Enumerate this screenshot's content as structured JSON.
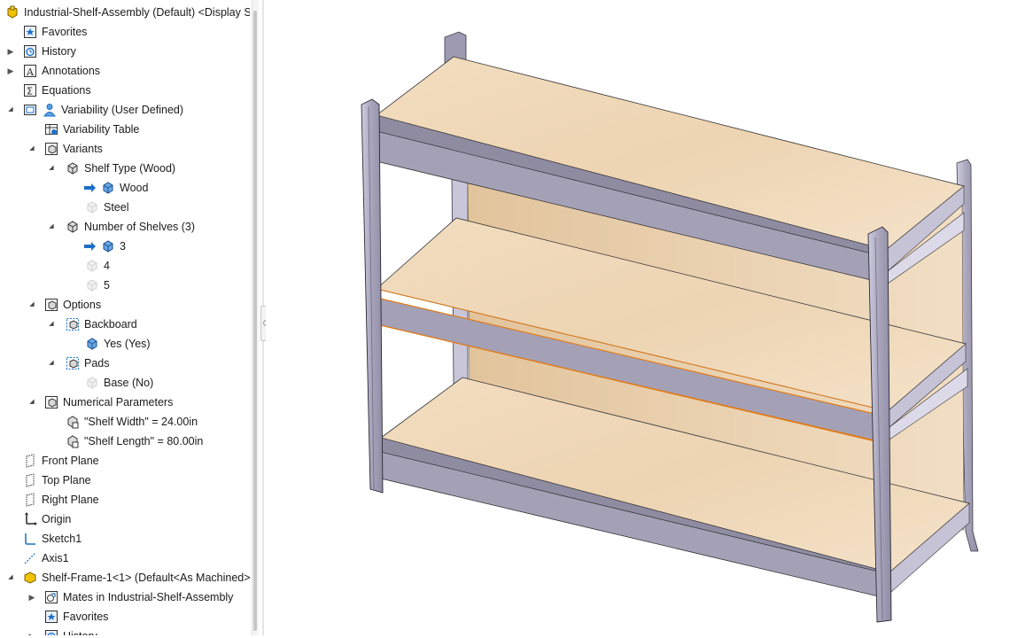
{
  "colors": {
    "wood": "#efd9bb",
    "metal": "#a7a4b8",
    "metal_dark": "#8c89a0",
    "highlight": "#e07a16",
    "arrow_blue": "#1c6fc9"
  },
  "tree": {
    "items": [
      {
        "label": "Industrial-Shelf-Assembly (Default) <Display Sta",
        "icon": "assembly-icon",
        "indent": 0
      },
      {
        "label": "Favorites",
        "icon": "favorites-icon",
        "indent": 1
      },
      {
        "label": "History",
        "icon": "history-icon",
        "indent": 1
      },
      {
        "label": "Annotations",
        "icon": "annotations-icon",
        "indent": 1
      },
      {
        "label": "Equations",
        "icon": "equations-icon",
        "indent": 1
      },
      {
        "label": "Variability (User Defined)",
        "icon": "variability-icon",
        "indent": 1
      },
      {
        "label": "Variability Table",
        "icon": "variability-table-icon",
        "indent": 2
      },
      {
        "label": "Variants",
        "icon": "variants-icon",
        "indent": 2
      },
      {
        "label": "Shelf Type (Wood)",
        "icon": "parameter-icon",
        "indent": 3
      },
      {
        "label": "Wood",
        "icon": "value-icon",
        "indent": 4
      },
      {
        "label": "Steel",
        "icon": "value-icon",
        "indent": 4
      },
      {
        "label": "Number of Shelves (3)",
        "icon": "parameter-icon",
        "indent": 3
      },
      {
        "label": "3",
        "icon": "value-icon",
        "indent": 4
      },
      {
        "label": "4",
        "icon": "value-icon",
        "indent": 4
      },
      {
        "label": "5",
        "icon": "value-icon",
        "indent": 4
      },
      {
        "label": "Options",
        "icon": "options-icon",
        "indent": 2
      },
      {
        "label": "Backboard",
        "icon": "option-parameter-icon",
        "indent": 3
      },
      {
        "label": "Yes (Yes)",
        "icon": "value-icon",
        "indent": 4
      },
      {
        "label": "Pads",
        "icon": "option-parameter-icon",
        "indent": 3
      },
      {
        "label": "Base (No)",
        "icon": "value-icon",
        "indent": 4
      },
      {
        "label": "Numerical Parameters",
        "icon": "numerical-parameters-icon",
        "indent": 2
      },
      {
        "label": "\"Shelf Width\" = 24.00in",
        "icon": "numeric-value-icon",
        "indent": 3
      },
      {
        "label": "\"Shelf Length\" = 80.00in",
        "icon": "numeric-value-icon",
        "indent": 3
      },
      {
        "label": "Front Plane",
        "icon": "plane-icon",
        "indent": 1
      },
      {
        "label": "Top Plane",
        "icon": "plane-icon",
        "indent": 1
      },
      {
        "label": "Right Plane",
        "icon": "plane-icon",
        "indent": 1
      },
      {
        "label": "Origin",
        "icon": "origin-icon",
        "indent": 1
      },
      {
        "label": "Sketch1",
        "icon": "sketch-icon",
        "indent": 1
      },
      {
        "label": "Axis1",
        "icon": "axis-icon",
        "indent": 1
      },
      {
        "label": "Shelf-Frame-1<1> (Default<As Machined>",
        "icon": "part-icon",
        "indent": 1
      },
      {
        "label": "Mates in Industrial-Shelf-Assembly",
        "icon": "mates-icon",
        "indent": 2
      },
      {
        "label": "Favorites",
        "icon": "favorites-icon",
        "indent": 2
      },
      {
        "label": "History",
        "icon": "history-icon",
        "indent": 2
      }
    ]
  }
}
